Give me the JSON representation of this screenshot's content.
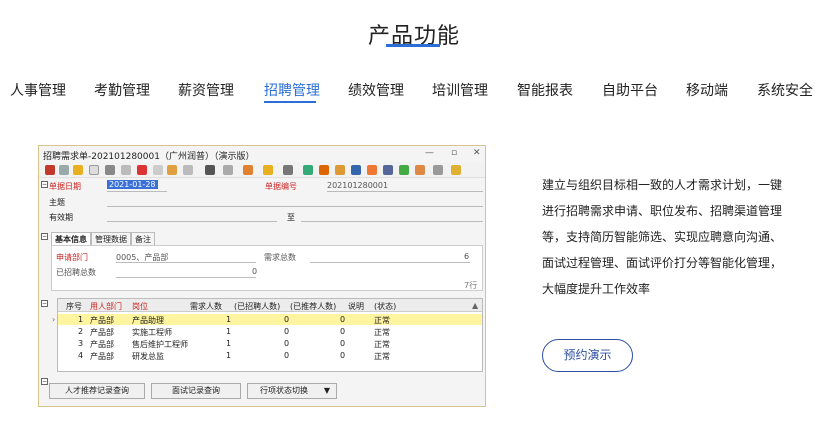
{
  "heading": "产品功能",
  "tabs": [
    "人事管理",
    "考勤管理",
    "薪资管理",
    "招聘管理",
    "绩效管理",
    "培训管理",
    "智能报表",
    "自助平台",
    "移动端",
    "系统安全"
  ],
  "active_tab": "招聘管理",
  "colors": {
    "accent": "#2b6fd6",
    "button_border": "#2b4fa0",
    "highlight_row": "#fff4a0",
    "label_red": "#cc2222"
  },
  "screenshot": {
    "window_title": "招聘需求单-202101280001（广州润普）（演示版）",
    "fields": {
      "doc_date_label": "单据日期",
      "doc_date_value": "2021-01-28",
      "doc_no_label": "单据编号",
      "doc_no_value": "202101280001",
      "subject_label": "主题",
      "valid_label": "有效期",
      "to_label": "至"
    },
    "subtabs": [
      "基本信息",
      "管理数据",
      "备注"
    ],
    "panel": {
      "dept_label": "申请部门",
      "dept_value": "0005、产品部",
      "need_total_label": "需求总数",
      "need_total_value": "6",
      "recruited_label": "已招聘总数",
      "recruited_value": "0",
      "row_count": "7行"
    },
    "grid": {
      "headers": [
        "序号",
        "用人部门",
        "岗位",
        "需求人数",
        "(已招聘人数)",
        "(已推荐人数)",
        "说明",
        "(状态)"
      ],
      "rows": [
        [
          "1",
          "产品部",
          "产品助理",
          "1",
          "0",
          "0",
          "",
          "正常"
        ],
        [
          "2",
          "产品部",
          "实施工程师",
          "1",
          "0",
          "0",
          "",
          "正常"
        ],
        [
          "3",
          "产品部",
          "售后维护工程师",
          "1",
          "0",
          "0",
          "",
          "正常"
        ],
        [
          "4",
          "产品部",
          "研发总监",
          "1",
          "0",
          "0",
          "",
          "正常"
        ]
      ]
    },
    "footer_buttons": [
      "人才推荐记录查询",
      "面试记录查询",
      "行项状态切换"
    ]
  },
  "description": [
    "建立与组织目标相一致的人才需求计划，一键",
    "进行招聘需求申请、职位发布、招聘渠道管理",
    "等，支持简历智能筛选、实现应聘意向沟通、",
    "面试过程管理、面试评价打分等智能化管理，",
    "大幅度提升工作效率"
  ],
  "demo_button": "预约演示"
}
